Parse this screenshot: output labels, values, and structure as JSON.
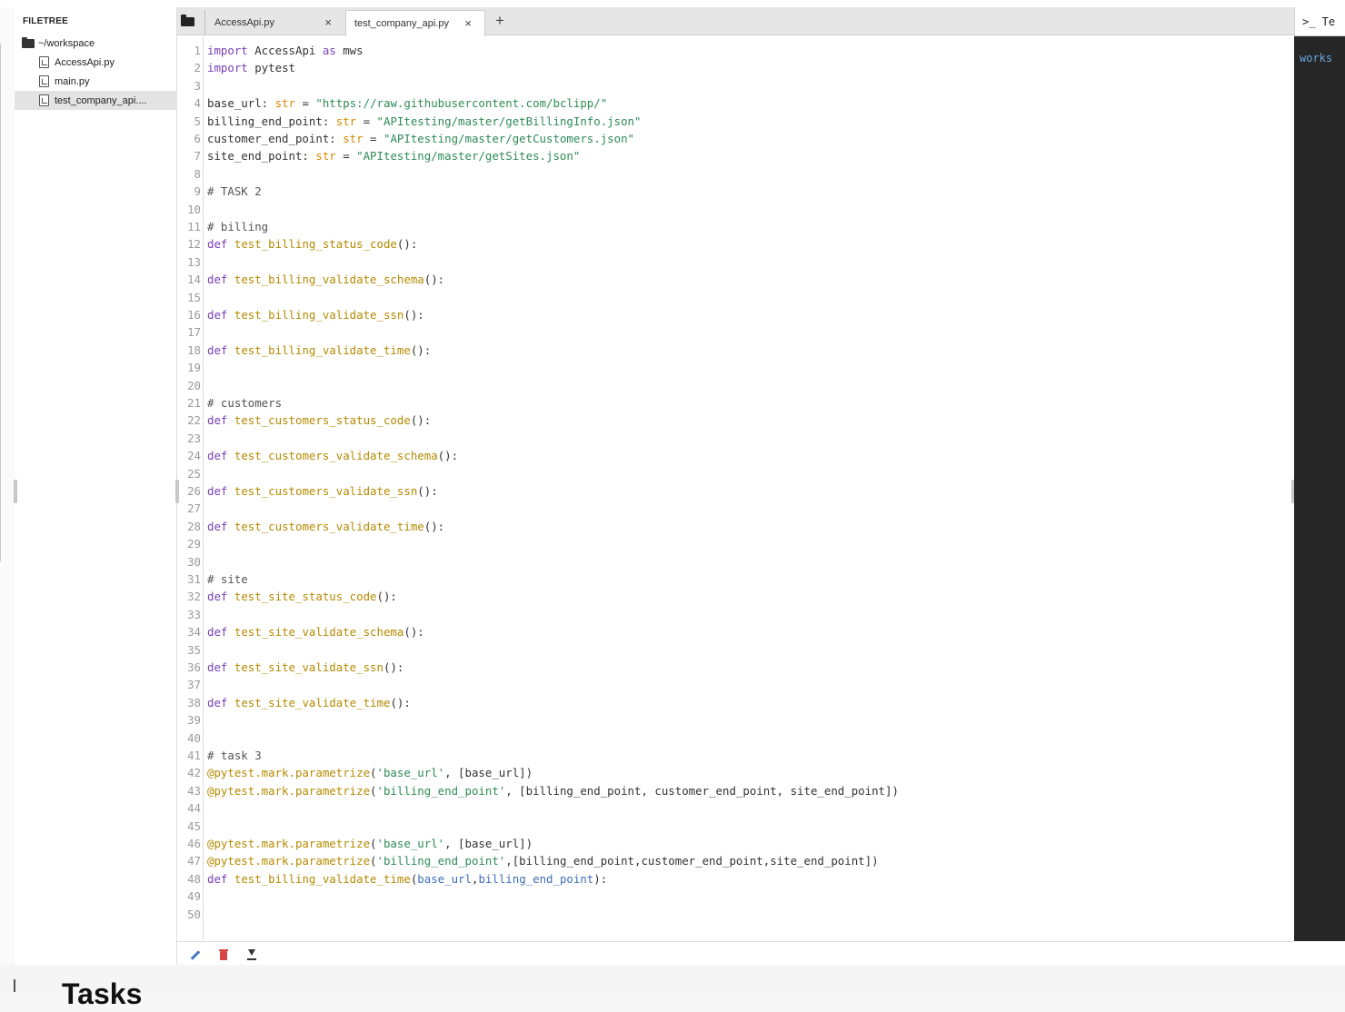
{
  "filetree": {
    "title": "FILETREE",
    "root": "~/workspace",
    "files": [
      "AccessApi.py",
      "main.py",
      "test_company_api...."
    ],
    "selected_index": 2
  },
  "tabs": [
    {
      "label": "AccessApi.py",
      "close": "×",
      "active": false
    },
    {
      "label": "test_company_api.py",
      "close": "×",
      "active": true
    }
  ],
  "add_tab_label": "+",
  "code_lines": [
    {
      "n": "1",
      "t": [
        [
          "kw",
          "import"
        ],
        [
          "p",
          " AccessApi "
        ],
        [
          "kw",
          "as"
        ],
        [
          "p",
          " mws"
        ]
      ]
    },
    {
      "n": "2",
      "t": [
        [
          "kw",
          "import"
        ],
        [
          "p",
          " pytest"
        ]
      ]
    },
    {
      "n": "3",
      "t": []
    },
    {
      "n": "4",
      "t": [
        [
          "p",
          "base_url: "
        ],
        [
          "type",
          "str"
        ],
        [
          "p",
          " = "
        ],
        [
          "str",
          "\"https://raw.githubusercontent.com/bclipp/\""
        ]
      ]
    },
    {
      "n": "5",
      "t": [
        [
          "p",
          "billing_end_point: "
        ],
        [
          "type",
          "str"
        ],
        [
          "p",
          " = "
        ],
        [
          "str",
          "\"APItesting/master/getBillingInfo.json\""
        ]
      ]
    },
    {
      "n": "6",
      "t": [
        [
          "p",
          "customer_end_point: "
        ],
        [
          "type",
          "str"
        ],
        [
          "p",
          " = "
        ],
        [
          "str",
          "\"APItesting/master/getCustomers.json\""
        ]
      ]
    },
    {
      "n": "7",
      "t": [
        [
          "p",
          "site_end_point: "
        ],
        [
          "type",
          "str"
        ],
        [
          "p",
          " = "
        ],
        [
          "str",
          "\"APItesting/master/getSites.json\""
        ]
      ]
    },
    {
      "n": "8",
      "t": []
    },
    {
      "n": "9",
      "t": [
        [
          "cm",
          "# TASK 2"
        ]
      ]
    },
    {
      "n": "10",
      "t": []
    },
    {
      "n": "11",
      "t": [
        [
          "cm",
          "# billing"
        ]
      ]
    },
    {
      "n": "12",
      "t": [
        [
          "kw",
          "def"
        ],
        [
          "p",
          " "
        ],
        [
          "fn",
          "test_billing_status_code"
        ],
        [
          "p",
          "():"
        ]
      ]
    },
    {
      "n": "13",
      "t": []
    },
    {
      "n": "14",
      "t": [
        [
          "kw",
          "def"
        ],
        [
          "p",
          " "
        ],
        [
          "fn",
          "test_billing_validate_schema"
        ],
        [
          "p",
          "():"
        ]
      ]
    },
    {
      "n": "15",
      "t": []
    },
    {
      "n": "16",
      "t": [
        [
          "kw",
          "def"
        ],
        [
          "p",
          " "
        ],
        [
          "fn",
          "test_billing_validate_ssn"
        ],
        [
          "p",
          "():"
        ]
      ]
    },
    {
      "n": "17",
      "t": []
    },
    {
      "n": "18",
      "t": [
        [
          "kw",
          "def"
        ],
        [
          "p",
          " "
        ],
        [
          "fn",
          "test_billing_validate_time"
        ],
        [
          "p",
          "():"
        ]
      ]
    },
    {
      "n": "19",
      "t": []
    },
    {
      "n": "20",
      "t": []
    },
    {
      "n": "21",
      "t": [
        [
          "cm",
          "# customers"
        ]
      ]
    },
    {
      "n": "22",
      "t": [
        [
          "kw",
          "def"
        ],
        [
          "p",
          " "
        ],
        [
          "fn",
          "test_customers_status_code"
        ],
        [
          "p",
          "():"
        ]
      ]
    },
    {
      "n": "23",
      "t": []
    },
    {
      "n": "24",
      "t": [
        [
          "kw",
          "def"
        ],
        [
          "p",
          " "
        ],
        [
          "fn",
          "test_customers_validate_schema"
        ],
        [
          "p",
          "():"
        ]
      ]
    },
    {
      "n": "25",
      "t": []
    },
    {
      "n": "26",
      "t": [
        [
          "kw",
          "def"
        ],
        [
          "p",
          " "
        ],
        [
          "fn",
          "test_customers_validate_ssn"
        ],
        [
          "p",
          "():"
        ]
      ]
    },
    {
      "n": "27",
      "t": []
    },
    {
      "n": "28",
      "t": [
        [
          "kw",
          "def"
        ],
        [
          "p",
          " "
        ],
        [
          "fn",
          "test_customers_validate_time"
        ],
        [
          "p",
          "():"
        ]
      ]
    },
    {
      "n": "29",
      "t": []
    },
    {
      "n": "30",
      "t": []
    },
    {
      "n": "31",
      "t": [
        [
          "cm",
          "# site"
        ]
      ]
    },
    {
      "n": "32",
      "t": [
        [
          "kw",
          "def"
        ],
        [
          "p",
          " "
        ],
        [
          "fn",
          "test_site_status_code"
        ],
        [
          "p",
          "():"
        ]
      ]
    },
    {
      "n": "33",
      "t": []
    },
    {
      "n": "34",
      "t": [
        [
          "kw",
          "def"
        ],
        [
          "p",
          " "
        ],
        [
          "fn",
          "test_site_validate_schema"
        ],
        [
          "p",
          "():"
        ]
      ]
    },
    {
      "n": "35",
      "t": []
    },
    {
      "n": "36",
      "t": [
        [
          "kw",
          "def"
        ],
        [
          "p",
          " "
        ],
        [
          "fn",
          "test_site_validate_ssn"
        ],
        [
          "p",
          "():"
        ]
      ]
    },
    {
      "n": "37",
      "t": []
    },
    {
      "n": "38",
      "t": [
        [
          "kw",
          "def"
        ],
        [
          "p",
          " "
        ],
        [
          "fn",
          "test_site_validate_time"
        ],
        [
          "p",
          "():"
        ]
      ]
    },
    {
      "n": "39",
      "t": []
    },
    {
      "n": "40",
      "t": []
    },
    {
      "n": "41",
      "t": [
        [
          "cm",
          "# task 3"
        ]
      ]
    },
    {
      "n": "42",
      "t": [
        [
          "dec",
          "@pytest.mark.parametrize"
        ],
        [
          "p",
          "("
        ],
        [
          "str",
          "'base_url'"
        ],
        [
          "p",
          ", [base_url])"
        ]
      ]
    },
    {
      "n": "43",
      "t": [
        [
          "dec",
          "@pytest.mark.parametrize"
        ],
        [
          "p",
          "("
        ],
        [
          "str",
          "'billing_end_point'"
        ],
        [
          "p",
          ", [billing_end_point, customer_end_point, site_end_point])"
        ]
      ]
    },
    {
      "n": "44",
      "t": []
    },
    {
      "n": "45",
      "t": []
    },
    {
      "n": "46",
      "t": [
        [
          "dec",
          "@pytest.mark.parametrize"
        ],
        [
          "p",
          "("
        ],
        [
          "str",
          "'base_url'"
        ],
        [
          "p",
          ", [base_url])"
        ]
      ]
    },
    {
      "n": "47",
      "t": [
        [
          "dec",
          "@pytest.mark.parametrize"
        ],
        [
          "p",
          "("
        ],
        [
          "str",
          "'billing_end_point'"
        ],
        [
          "p",
          ",[billing_end_point,customer_end_point,site_end_point])"
        ]
      ]
    },
    {
      "n": "48",
      "t": [
        [
          "kw",
          "def"
        ],
        [
          "p",
          " "
        ],
        [
          "fn",
          "test_billing_validate_time"
        ],
        [
          "p",
          "("
        ],
        [
          "param",
          "base_url"
        ],
        [
          "p",
          ","
        ],
        [
          "param",
          "billing_end_point"
        ],
        [
          "p",
          "):"
        ]
      ]
    },
    {
      "n": "49",
      "t": []
    },
    {
      "n": "50",
      "t": []
    }
  ],
  "footer_icons": [
    "pencil-icon",
    "trash-icon",
    "download-icon"
  ],
  "terminal": {
    "label": ">_ Te",
    "text": "works"
  },
  "bottom": {
    "heading": "Tasks"
  },
  "colors": {
    "keyword": "#7a3fb5",
    "function": "#b58a00",
    "string": "#2e8b57",
    "type": "#d68a00",
    "terminal_bg": "#262626"
  }
}
